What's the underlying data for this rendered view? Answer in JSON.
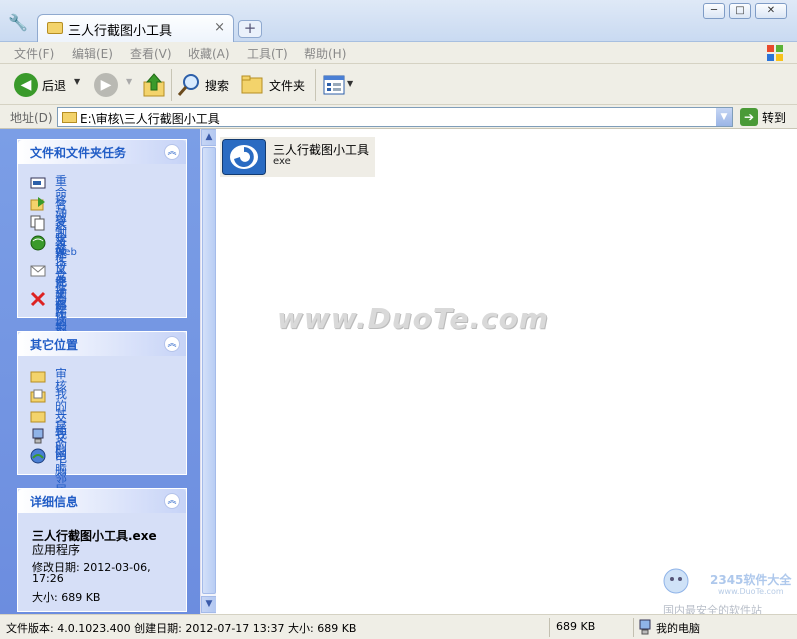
{
  "titlebar": {
    "tab_title": "三人行截图小工具",
    "close_tab": "×",
    "new_tab": "+",
    "window_buttons": [
      "─",
      "□",
      "✕"
    ]
  },
  "menu": [
    {
      "label": "文件(F)"
    },
    {
      "label": "编辑(E)"
    },
    {
      "label": "查看(V)"
    },
    {
      "label": "收藏(A)"
    },
    {
      "label": "工具(T)"
    },
    {
      "label": "帮助(H)"
    }
  ],
  "toolbar": {
    "back": "后退",
    "search": "搜索",
    "folders": "文件夹"
  },
  "address": {
    "label": "地址(D)",
    "path": "E:\\审核\\三人行截图小工具",
    "go": "转到"
  },
  "tasks_panel": {
    "title": "文件和文件夹任务",
    "items": [
      {
        "label": "重命名这个文件"
      },
      {
        "label": "移动这个文件"
      },
      {
        "label": "复制这个文件"
      },
      {
        "label": "将这个文件发布到",
        "sub": "Web"
      },
      {
        "label": "以电子邮件形式发送",
        "label2": "此文件"
      },
      {
        "label": "删除这个文件"
      }
    ]
  },
  "places_panel": {
    "title": "其它位置",
    "items": [
      {
        "label": "审核"
      },
      {
        "label": "我的文档"
      },
      {
        "label": "共享文档"
      },
      {
        "label": "我的电脑"
      },
      {
        "label": "网上邻居"
      }
    ]
  },
  "details_panel": {
    "title": "详细信息",
    "filename": "三人行截图小工具.exe",
    "type": "应用程序",
    "modified_label": "修改日期: 2012-03-06,",
    "modified_time": "17:26",
    "size": "大小: 689 KB"
  },
  "file": {
    "name": "三人行截图小工具",
    "ext": "exe"
  },
  "watermark": "www.DuoTe.com",
  "corner_watermark": {
    "brand": "2345软件大全",
    "site": "www.DuoTe.com",
    "slogan": "国内最安全的软件站"
  },
  "status": {
    "left": "文件版本: 4.0.1023.400 创建日期: 2012-07-17 13:37 大小: 689 KB",
    "size": "689 KB",
    "location": "我的电脑"
  },
  "colors": {
    "pane_blue": "#6c8ddf",
    "link_blue": "#215dc6"
  }
}
